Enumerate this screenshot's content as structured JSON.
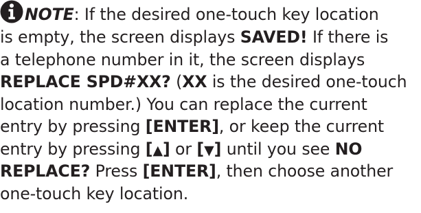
{
  "note": {
    "label": "NOTE",
    "sep": ": ",
    "l1": "If the desired one-touch key location",
    "l2a": "is empty, the screen displays ",
    "l2b": "SAVED!",
    "l2c": " If there is",
    "l3": "a telephone number in it, the screen displays",
    "l4a": "REPLACE SPD#XX?",
    "l4b": " (",
    "l4c": "XX",
    "l4d": " is the desired one-touch",
    "l5": "location number.) You can replace the current",
    "l6a": "entry by pressing ",
    "l6b": "[ENTER]",
    "l6c": ", or keep the current",
    "l7a": "entry by pressing ",
    "l7b": "[",
    "l7up": "▲",
    "l7c": "]",
    "l7d": " or ",
    "l7e": "[",
    "l7down": "▼",
    "l7f": "]",
    "l7g": " until you see ",
    "l7h": "NO",
    "l8a": "REPLACE?",
    "l8b": " Press ",
    "l8c": "[ENTER]",
    "l8d": ", then choose another",
    "l9": "one-touch key location."
  },
  "icons": {
    "info": "info-icon"
  },
  "colors": {
    "text": "#231f20"
  }
}
